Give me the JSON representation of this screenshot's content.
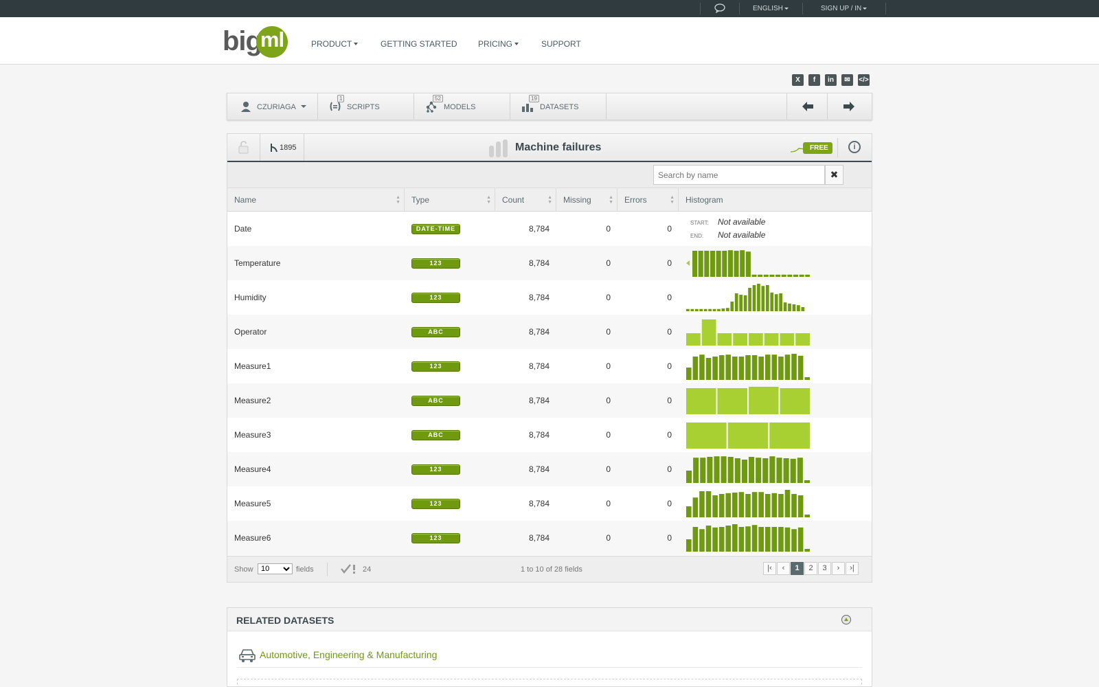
{
  "topbar": {
    "language": "ENGLISH",
    "signup": "SIGN UP / IN"
  },
  "header": {
    "logo_big": "big",
    "logo_ml": "ml",
    "nav": [
      {
        "label": "PRODUCT",
        "has_caret": true
      },
      {
        "label": "GETTING STARTED",
        "has_caret": false
      },
      {
        "label": "PRICING",
        "has_caret": true
      },
      {
        "label": "SUPPORT",
        "has_caret": false
      }
    ]
  },
  "share_icons": [
    "x-icon",
    "facebook-icon",
    "linkedin-icon",
    "email-icon",
    "embed-code-icon"
  ],
  "toolbar": {
    "user": "CZURIAGA",
    "scripts": {
      "label": "SCRIPTS",
      "count": "1"
    },
    "models": {
      "label": "MODELS",
      "count": "52"
    },
    "datasets": {
      "label": "DATASETS",
      "count": "19"
    }
  },
  "dataset": {
    "title": "Machine failures",
    "clone_count": "1895",
    "price_tag": "FREE",
    "search_placeholder": "Search by name",
    "columns": [
      "Name",
      "Type",
      "Count",
      "Missing",
      "Errors",
      "Histogram"
    ],
    "date_start_label": "START:",
    "date_end_label": "END:",
    "date_start_value": "Not available",
    "date_end_value": "Not available",
    "rows": [
      {
        "name": "Date",
        "type": "DATE-TIME",
        "count": "8,784",
        "missing": "0",
        "errors": "0",
        "hist": null
      },
      {
        "name": "Temperature",
        "type": "123",
        "count": "8,784",
        "missing": "0",
        "errors": "0",
        "hist": [
          0.95,
          0.95,
          0.95,
          0.95,
          0.95,
          0.95,
          0.97,
          0.95,
          0.97,
          0.92,
          0.08,
          0.08,
          0.08,
          0.08,
          0.08,
          0.08,
          0.08,
          0.08,
          0.08,
          0.08
        ],
        "left_arrow": true
      },
      {
        "name": "Humidity",
        "type": "123",
        "count": "8,784",
        "missing": "0",
        "errors": "0",
        "hist": [
          0.08,
          0.08,
          0.08,
          0.08,
          0.08,
          0.08,
          0.08,
          0.08,
          0.1,
          0.12,
          0.35,
          0.65,
          0.6,
          0.58,
          0.85,
          0.95,
          1.0,
          0.92,
          0.95,
          0.68,
          0.62,
          0.65,
          0.32,
          0.28,
          0.25,
          0.22,
          0.15
        ],
        "right_arrow": true
      },
      {
        "name": "Operator",
        "type": "ABC",
        "count": "8,784",
        "missing": "0",
        "errors": "0",
        "hist": [
          0.45,
          0.95,
          0.45,
          0.45,
          0.45,
          0.45,
          0.45,
          0.45
        ],
        "categorical": true
      },
      {
        "name": "Measure1",
        "type": "123",
        "count": "8,784",
        "missing": "0",
        "errors": "0",
        "hist": [
          0.45,
          0.85,
          0.92,
          0.8,
          0.85,
          0.9,
          0.92,
          0.85,
          0.85,
          0.9,
          0.9,
          0.85,
          0.92,
          0.92,
          0.85,
          0.92,
          0.95,
          0.88,
          0.1
        ]
      },
      {
        "name": "Measure2",
        "type": "ABC",
        "count": "8,784",
        "missing": "0",
        "errors": "0",
        "hist": [
          0.95,
          0.95,
          1.0,
          0.95
        ],
        "categorical": true
      },
      {
        "name": "Measure3",
        "type": "ABC",
        "count": "8,784",
        "missing": "0",
        "errors": "0",
        "hist": [
          0.95,
          0.95,
          0.95
        ],
        "categorical": true
      },
      {
        "name": "Measure4",
        "type": "123",
        "count": "8,784",
        "missing": "0",
        "errors": "0",
        "hist": [
          0.45,
          0.92,
          0.92,
          0.95,
          0.97,
          0.97,
          0.95,
          0.9,
          0.85,
          0.95,
          0.92,
          0.9,
          0.97,
          0.92,
          0.9,
          0.88,
          0.92,
          0.1
        ]
      },
      {
        "name": "Measure5",
        "type": "123",
        "count": "8,784",
        "missing": "0",
        "errors": "0",
        "hist": [
          0.4,
          0.72,
          0.95,
          0.95,
          0.8,
          0.85,
          0.88,
          0.9,
          0.92,
          0.85,
          0.92,
          0.92,
          0.85,
          0.88,
          0.85,
          1.0,
          0.85,
          0.8,
          0.1
        ]
      },
      {
        "name": "Measure6",
        "type": "123",
        "count": "8,784",
        "missing": "0",
        "errors": "0",
        "hist": [
          0.45,
          0.9,
          0.82,
          0.95,
          0.88,
          0.9,
          0.95,
          1.0,
          0.9,
          0.92,
          0.97,
          0.9,
          0.9,
          0.9,
          0.9,
          0.88,
          0.82,
          0.88,
          0.1
        ]
      }
    ],
    "footer": {
      "show_label": "Show",
      "show_value": "10",
      "fields_label": "fields",
      "flagged_count": "24",
      "range_text": "1 to 10 of 28 fields",
      "pages": [
        "1",
        "2",
        "3"
      ],
      "current_page": "1"
    }
  },
  "related": {
    "title": "RELATED DATASETS",
    "category": "Automotive, Engineering & Manufacturing"
  },
  "colors": {
    "accent_green": "#7ea51a",
    "dark_green": "#6f9a10",
    "hist_light": "#a9d033",
    "dark_header": "#2f3b3f"
  }
}
